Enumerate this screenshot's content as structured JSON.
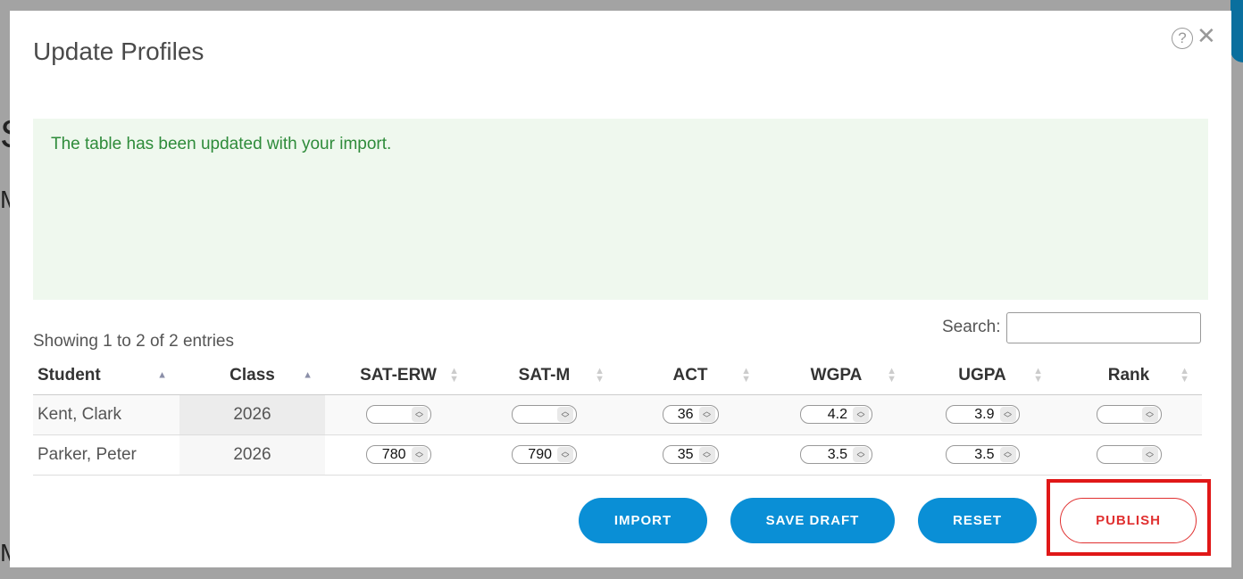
{
  "background": {
    "letters": [
      "S",
      "M",
      "M"
    ]
  },
  "modal": {
    "title": "Update Profiles",
    "help_icon": "?",
    "close_icon": "✕",
    "alert_message": "The table has been updated with your import.",
    "entries_info": "Showing 1 to 2 of 2 entries",
    "search": {
      "label": "Search:",
      "value": ""
    },
    "table": {
      "columns": [
        "Student",
        "Class",
        "SAT-ERW",
        "SAT-M",
        "ACT",
        "WGPA",
        "UGPA",
        "Rank"
      ],
      "rows": [
        {
          "student": "Kent, Clark",
          "class": "2026",
          "sat_erw": "",
          "sat_m": "",
          "act": "36",
          "wgpa": "4.2",
          "ugpa": "3.9",
          "rank": ""
        },
        {
          "student": "Parker, Peter",
          "class": "2026",
          "sat_erw": "780",
          "sat_m": "790",
          "act": "35",
          "wgpa": "3.5",
          "ugpa": "3.5",
          "rank": ""
        }
      ]
    },
    "buttons": {
      "import": "IMPORT",
      "save_draft": "SAVE DRAFT",
      "reset": "RESET",
      "publish": "PUBLISH"
    }
  },
  "colors": {
    "primary_button": "#0a8fd6",
    "publish_text": "#e03030",
    "alert_bg": "#eff8ee",
    "alert_text": "#2e8b3a",
    "highlight": "#e01818"
  }
}
